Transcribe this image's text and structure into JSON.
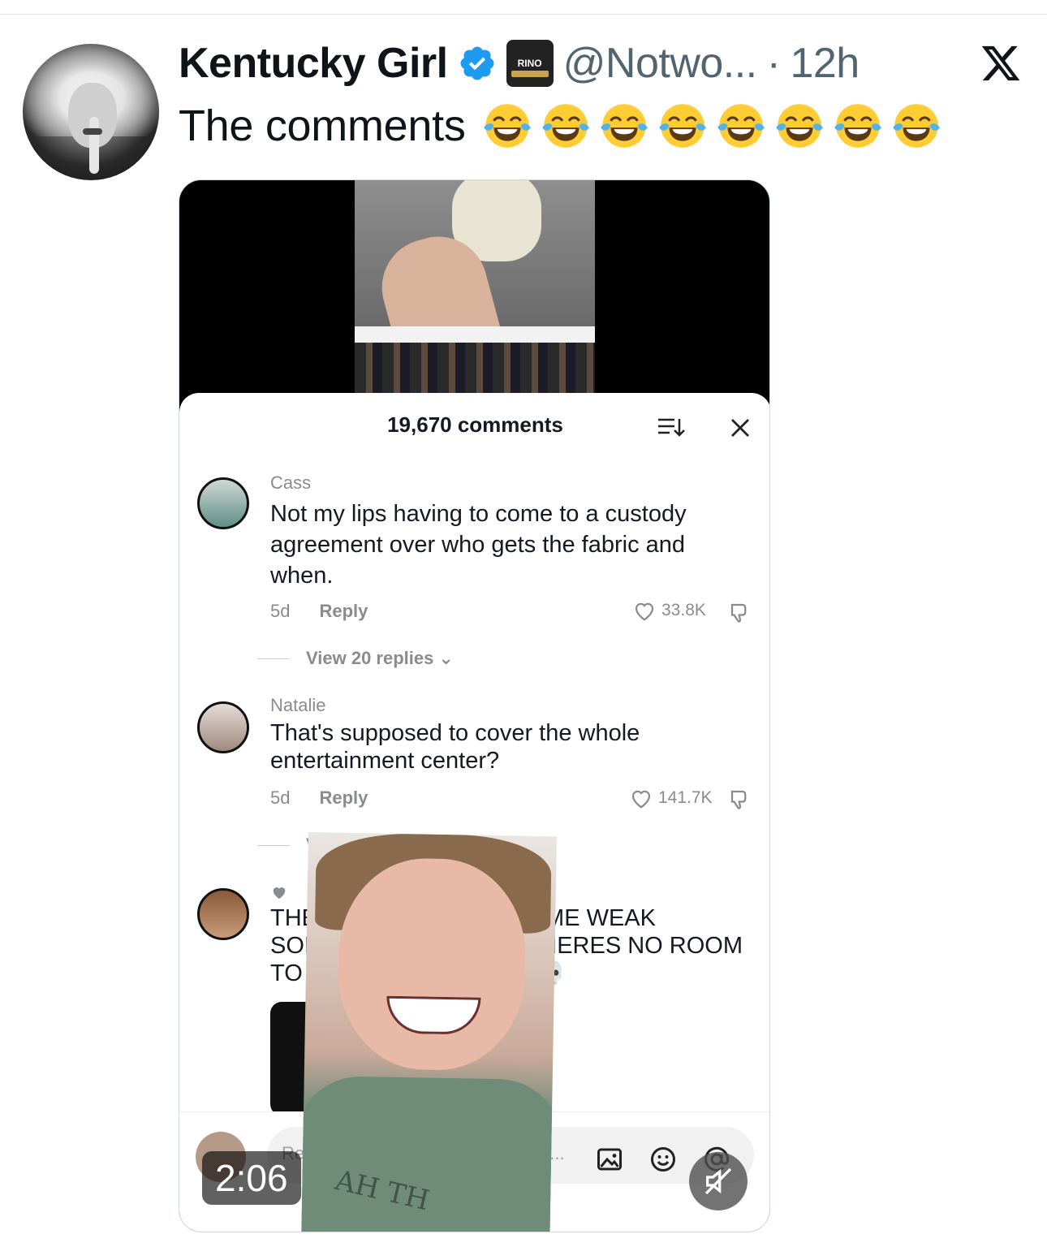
{
  "tweet": {
    "author_name": "Kentucky Girl",
    "handle": "@Notwo...",
    "separator": "·",
    "time": "12h",
    "text": "The comments",
    "emoji_count": 8,
    "affiliate_badge_text": "RINO"
  },
  "video": {
    "duration": "2:06",
    "comments_sheet": {
      "title": "19,670 comments",
      "comments": [
        {
          "author": "Cass",
          "text": "Not my lips having to come to a custody agreement over who gets the fabric and when.",
          "age": "5d",
          "reply_label": "Reply",
          "likes": "33.8K",
          "view_replies": "View 20 replies"
        },
        {
          "author": "Natalie",
          "text": "That's supposed to cover the whole entertainment center?",
          "age": "5d",
          "reply_label": "Reply",
          "likes": "141.7K",
          "view_replies": "Vi"
        }
      ],
      "partial_comment": {
        "line1_left": "THESE",
        "line1_right": "VE ME WEAK",
        "line2_left": "SOME",
        "line2_right": "THERES NO ROOM",
        "line3_left": "TO",
        "line3_right": "T 💀"
      },
      "input_placeholder": "Re",
      "input_placeholder_tail": "g..."
    },
    "overlay_shirt_text": "AH TH"
  },
  "colors": {
    "verified_blue": "#1d9bf0",
    "text_primary": "#0f1419",
    "text_secondary": "#536471"
  },
  "icons": [
    "verified-badge-icon",
    "x-logo-icon",
    "laughing-emoji-icon",
    "sort-icon",
    "close-icon",
    "heart-icon",
    "dislike-icon",
    "image-icon",
    "emoji-icon",
    "mention-icon",
    "mute-icon"
  ]
}
